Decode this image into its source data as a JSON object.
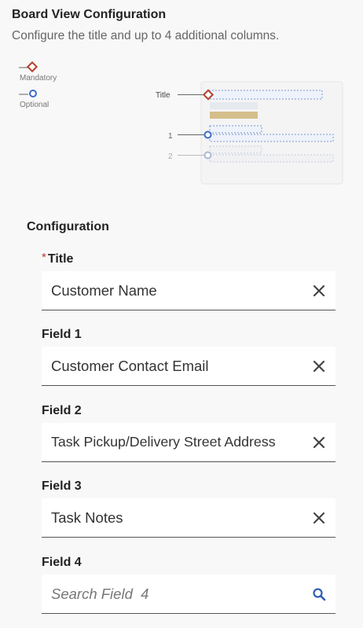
{
  "header": {
    "title": "Board View Configuration",
    "subtitle": "Configure the title and up to 4 additional columns."
  },
  "legend": {
    "mandatory_label": "Mandatory",
    "optional_label": "Optional"
  },
  "diagram": {
    "title_label": "Title",
    "row1_label": "1",
    "row2_label": "2"
  },
  "configuration": {
    "section_title": "Configuration",
    "title_field": {
      "required_marker": "*",
      "label": "Title",
      "value": "Customer Name"
    },
    "fields": [
      {
        "label": "Field 1",
        "value": "Customer Contact Email",
        "placeholder": ""
      },
      {
        "label": "Field 2",
        "value": "Task Pickup/Delivery Street Address",
        "placeholder": ""
      },
      {
        "label": "Field 3",
        "value": "Task Notes",
        "placeholder": ""
      },
      {
        "label": "Field 4",
        "value": "",
        "placeholder": "Search Field  4"
      }
    ]
  },
  "icons": {
    "clear": "close-icon",
    "search": "search-icon",
    "mandatory": "diamond-icon",
    "optional": "circle-icon"
  },
  "colors": {
    "mandatory": "#b5402c",
    "optional": "#3b6cc7",
    "optional_faded": "#a9b8d6",
    "accent_bar": "#d4bf8b",
    "search_icon": "#2f5fb3"
  }
}
